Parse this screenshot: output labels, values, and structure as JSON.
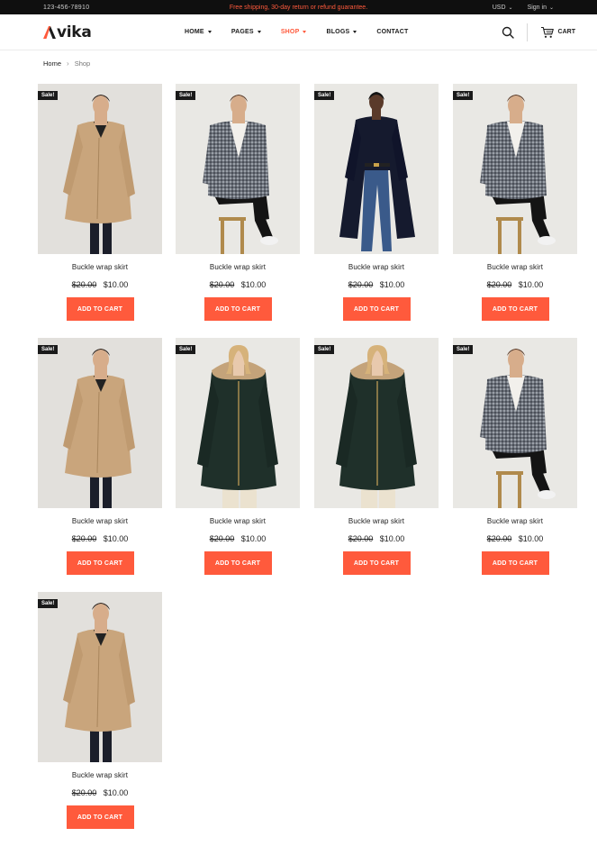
{
  "topbar": {
    "phone": "123-456-78910",
    "promo": "Free shipping, 30-day return or refund guarantee.",
    "currency": "USD",
    "signin": "Sign in"
  },
  "header": {
    "logo_text": "vika",
    "logo_initial": "A",
    "nav": [
      {
        "label": "HOME",
        "has_caret": true
      },
      {
        "label": "PAGES",
        "has_caret": true
      },
      {
        "label": "SHOP",
        "has_caret": true
      },
      {
        "label": "BLOGS",
        "has_caret": true
      },
      {
        "label": "CONTACT",
        "has_caret": false
      }
    ],
    "cart_label": "CART"
  },
  "breadcrumb": {
    "home": "Home",
    "current": "Shop"
  },
  "colors": {
    "accent": "#ff5a3c",
    "topbar_bg": "#0f0f0f",
    "badge_bg": "#1a1a1a"
  },
  "products": [
    {
      "name": "Buckle wrap skirt",
      "old_price": "$20.00",
      "price": "$10.00",
      "badge": "Sale!",
      "button": "ADD TO CART",
      "image": "man-beige-trench-coat"
    },
    {
      "name": "Buckle wrap skirt",
      "old_price": "$20.00",
      "price": "$10.00",
      "badge": "Sale!",
      "button": "ADD TO CART",
      "image": "man-check-coat-seated"
    },
    {
      "name": "Buckle wrap skirt",
      "old_price": "$20.00",
      "price": "$10.00",
      "badge": "Sale!",
      "button": "ADD TO CART",
      "image": "woman-navy-coat"
    },
    {
      "name": "Buckle wrap skirt",
      "old_price": "$20.00",
      "price": "$10.00",
      "badge": "Sale!",
      "button": "ADD TO CART",
      "image": "man-check-coat-seated"
    },
    {
      "name": "Buckle wrap skirt",
      "old_price": "$20.00",
      "price": "$10.00",
      "badge": "Sale!",
      "button": "ADD TO CART",
      "image": "man-beige-trench-coat"
    },
    {
      "name": "Buckle wrap skirt",
      "old_price": "$20.00",
      "price": "$10.00",
      "badge": "Sale!",
      "button": "ADD TO CART",
      "image": "woman-green-parka"
    },
    {
      "name": "Buckle wrap skirt",
      "old_price": "$20.00",
      "price": "$10.00",
      "badge": "Sale!",
      "button": "ADD TO CART",
      "image": "woman-green-parka"
    },
    {
      "name": "Buckle wrap skirt",
      "old_price": "$20.00",
      "price": "$10.00",
      "badge": "Sale!",
      "button": "ADD TO CART",
      "image": "man-check-coat-seated"
    },
    {
      "name": "Buckle wrap skirt",
      "old_price": "$20.00",
      "price": "$10.00",
      "badge": "Sale!",
      "button": "ADD TO CART",
      "image": "man-beige-trench-coat"
    }
  ]
}
